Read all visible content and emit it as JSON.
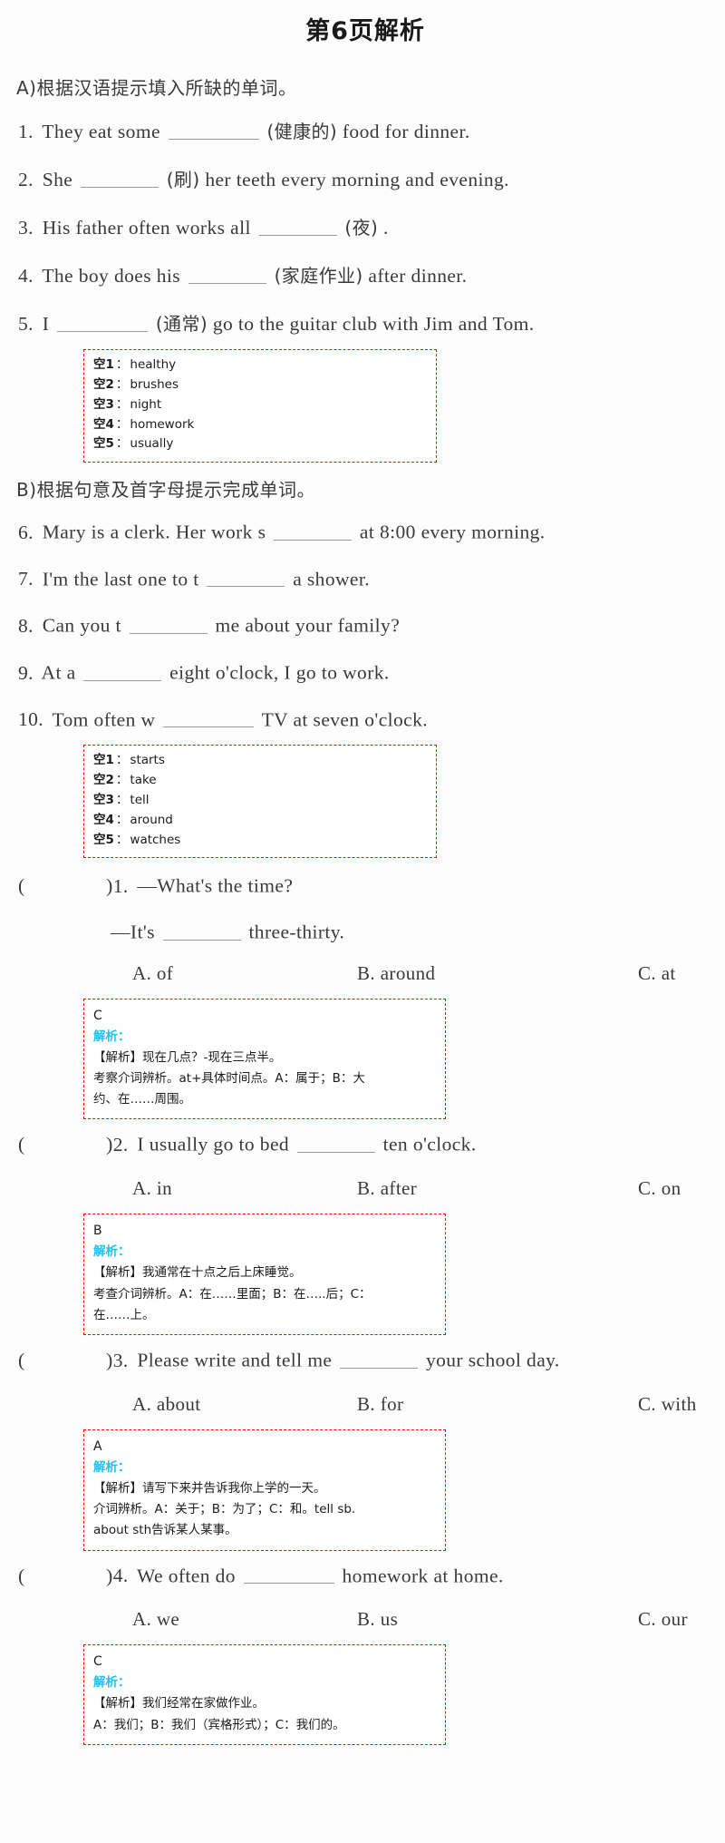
{
  "page": {
    "title": "第6页解析"
  },
  "section_a": {
    "heading": "A)根据汉语提示填入所缺的单词。",
    "questions": [
      {
        "num": "1.",
        "pre": "They eat some",
        "hint": "(健康的)",
        "post": "food for dinner."
      },
      {
        "num": "2.",
        "pre": "She",
        "hint": "(刷)",
        "post": "her teeth every morning and evening."
      },
      {
        "num": "3.",
        "pre": "His father often works all",
        "hint": "(夜)",
        "post": "."
      },
      {
        "num": "4.",
        "pre": "The boy does his",
        "hint": "(家庭作业)",
        "post": "after dinner."
      },
      {
        "num": "5.",
        "pre": "I",
        "hint": "(通常)",
        "post": "go to the guitar club with Jim and Tom."
      }
    ],
    "answers": [
      {
        "key": "空1",
        "sep": "：",
        "value": "healthy"
      },
      {
        "key": "空2",
        "sep": "：",
        "value": "brushes"
      },
      {
        "key": "空3",
        "sep": "：",
        "value": "night"
      },
      {
        "key": "空4",
        "sep": "：",
        "value": "homework"
      },
      {
        "key": "空5",
        "sep": "：",
        "value": "usually"
      }
    ]
  },
  "section_b": {
    "heading": "B)根据句意及首字母提示完成单词。",
    "questions": [
      {
        "num": "6.",
        "pre": "Mary is a clerk. Her work s",
        "post": "at 8:00 every morning."
      },
      {
        "num": "7.",
        "pre": "I'm the last one to t",
        "post": "a shower."
      },
      {
        "num": "8.",
        "pre": "Can you t",
        "post": "me about your family?"
      },
      {
        "num": "9.",
        "pre": "At a",
        "post": "eight o'clock, I go to work."
      },
      {
        "num": "10.",
        "pre": "Tom often w",
        "post": "TV at seven o'clock."
      }
    ],
    "answers": [
      {
        "key": "空1",
        "sep": "：",
        "value": "starts"
      },
      {
        "key": "空2",
        "sep": "：",
        "value": "take"
      },
      {
        "key": "空3",
        "sep": "：",
        "value": "tell"
      },
      {
        "key": "空4",
        "sep": "：",
        "value": "around"
      },
      {
        "key": "空5",
        "sep": "：",
        "value": "watches"
      }
    ]
  },
  "choice_questions": [
    {
      "bracket_open": "(",
      "bracket_close": ")",
      "num": "1.",
      "stem": "—What's the time?",
      "stem2_pre": "—It's",
      "stem2_post": "three-thirty.",
      "option_a": "A. of",
      "option_b": "B. around",
      "option_c": "C. at",
      "answer": "C",
      "label": "解析：",
      "explain_lines": [
        "【解析】现在几点？-现在三点半。",
        "考察介词辨析。at+具体时间点。A：属于；B：大",
        "约、在……周围。"
      ]
    },
    {
      "bracket_open": "(",
      "bracket_close": ")",
      "num": "2.",
      "stem_pre": "I usually go to bed",
      "stem_post": "ten o'clock.",
      "option_a": "A. in",
      "option_b": "B. after",
      "option_c": "C. on",
      "answer": "B",
      "label": "解析：",
      "explain_lines": [
        "【解析】我通常在十点之后上床睡觉。",
        "考查介词辨析。A：在……里面；B：在…..后；C：",
        "在……上。"
      ]
    },
    {
      "bracket_open": "(",
      "bracket_close": ")",
      "num": "3.",
      "stem_pre": "Please write and tell me",
      "stem_post": "your school day.",
      "option_a": "A. about",
      "option_b": "B. for",
      "option_c": "C. with",
      "answer": "A",
      "label": "解析：",
      "explain_lines": [
        "【解析】请写下来并告诉我你上学的一天。",
        "介词辨析。A：关于；B：为了；C：和。tell sb.",
        "about sth告诉某人某事。"
      ]
    },
    {
      "bracket_open": "(",
      "bracket_close": ")",
      "num": "4.",
      "stem_pre": "We often do",
      "stem_post": "homework at home.",
      "option_a": "A. we",
      "option_b": "B. us",
      "option_c": "C. our",
      "answer": "C",
      "label": "解析：",
      "explain_lines": [
        "【解析】我们经常在家做作业。",
        "A：我们；B：我们（宾格形式）；C：我们的。"
      ]
    }
  ],
  "colors": {
    "box_border": "#ff0000",
    "label": "#19c3ef",
    "text": "#2b2b2b"
  }
}
